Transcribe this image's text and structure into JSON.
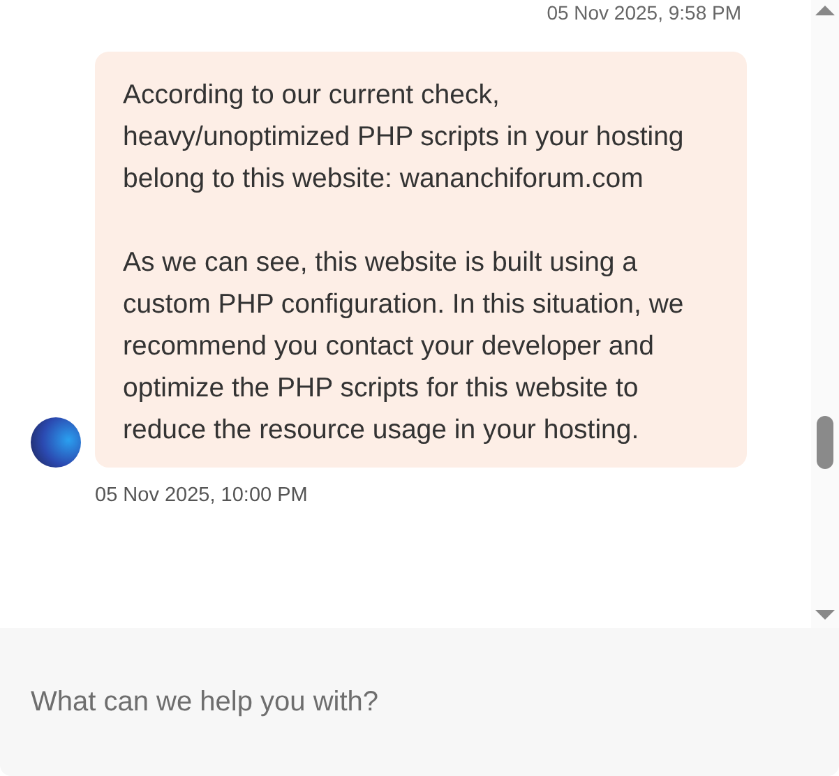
{
  "previous_message": {
    "timestamp": "05 Nov 2025, 9:58 PM"
  },
  "message": {
    "paragraphs": [
      "According to our current check, heavy/unoptimized PHP scripts in your hosting belong to this website: wananchiforum.com",
      "As we can see, this website is built using a custom PHP configuration. In this situation, we recommend you contact your developer and optimize the PHP scripts for this website to reduce the resource usage in your hosting."
    ],
    "timestamp": "05 Nov 2025, 10:00 PM"
  },
  "composer": {
    "placeholder": "What can we help you with?"
  }
}
